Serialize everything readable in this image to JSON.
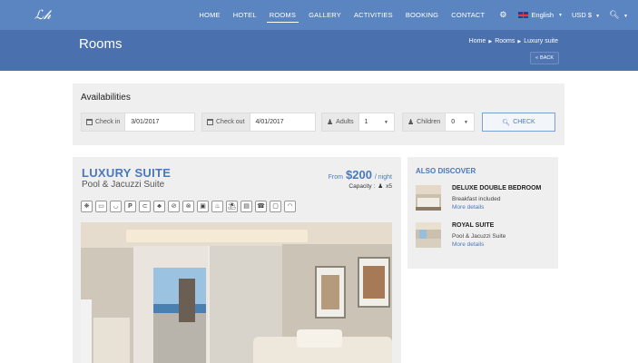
{
  "nav": {
    "logo_text": "ℒ𝒽",
    "items": [
      "HOME",
      "HOTEL",
      "ROOMS",
      "GALLERY",
      "ACTIVITIES",
      "BOOKING",
      "CONTACT"
    ],
    "active_index": 2,
    "language": "English",
    "currency": "USD $"
  },
  "header": {
    "title": "Rooms",
    "breadcrumb": [
      "Home",
      "Rooms",
      "Luxury suite"
    ],
    "back_label": "BACK"
  },
  "availability": {
    "title": "Availabilities",
    "checkin_label": "Check in",
    "checkin_value": "3/01/2017",
    "checkout_label": "Check out",
    "checkout_value": "4/01/2017",
    "adults_label": "Adults",
    "adults_value": "1",
    "children_label": "Children",
    "children_value": "0",
    "check_button": "CHECK"
  },
  "room": {
    "name": "LUXURY SUITE",
    "subtitle": "Pool & Jacuzzi Suite",
    "price_prefix": "From",
    "price": "$200",
    "price_suffix": "/ night",
    "capacity_label": "Capacity :",
    "capacity_value": "x5",
    "amenity_icons": [
      "fan-icon",
      "bed-icon",
      "bathtub-icon",
      "parking-icon",
      "hairdryer-icon",
      "plant-icon",
      "no-smoking-icon",
      "no-pets-icon",
      "safe-icon",
      "room-service-icon",
      "beach-icon",
      "briefcase-icon",
      "phone-icon",
      "tv-icon",
      "wifi-icon"
    ]
  },
  "discover": {
    "title": "ALSO DISCOVER",
    "items": [
      {
        "name": "DELUXE DOUBLE BEDROOM",
        "subtitle": "Breakfast included",
        "more": "More details"
      },
      {
        "name": "ROYAL SUITE",
        "subtitle": "Pool & Jacuzzi Suite",
        "more": "More details"
      }
    ]
  }
}
